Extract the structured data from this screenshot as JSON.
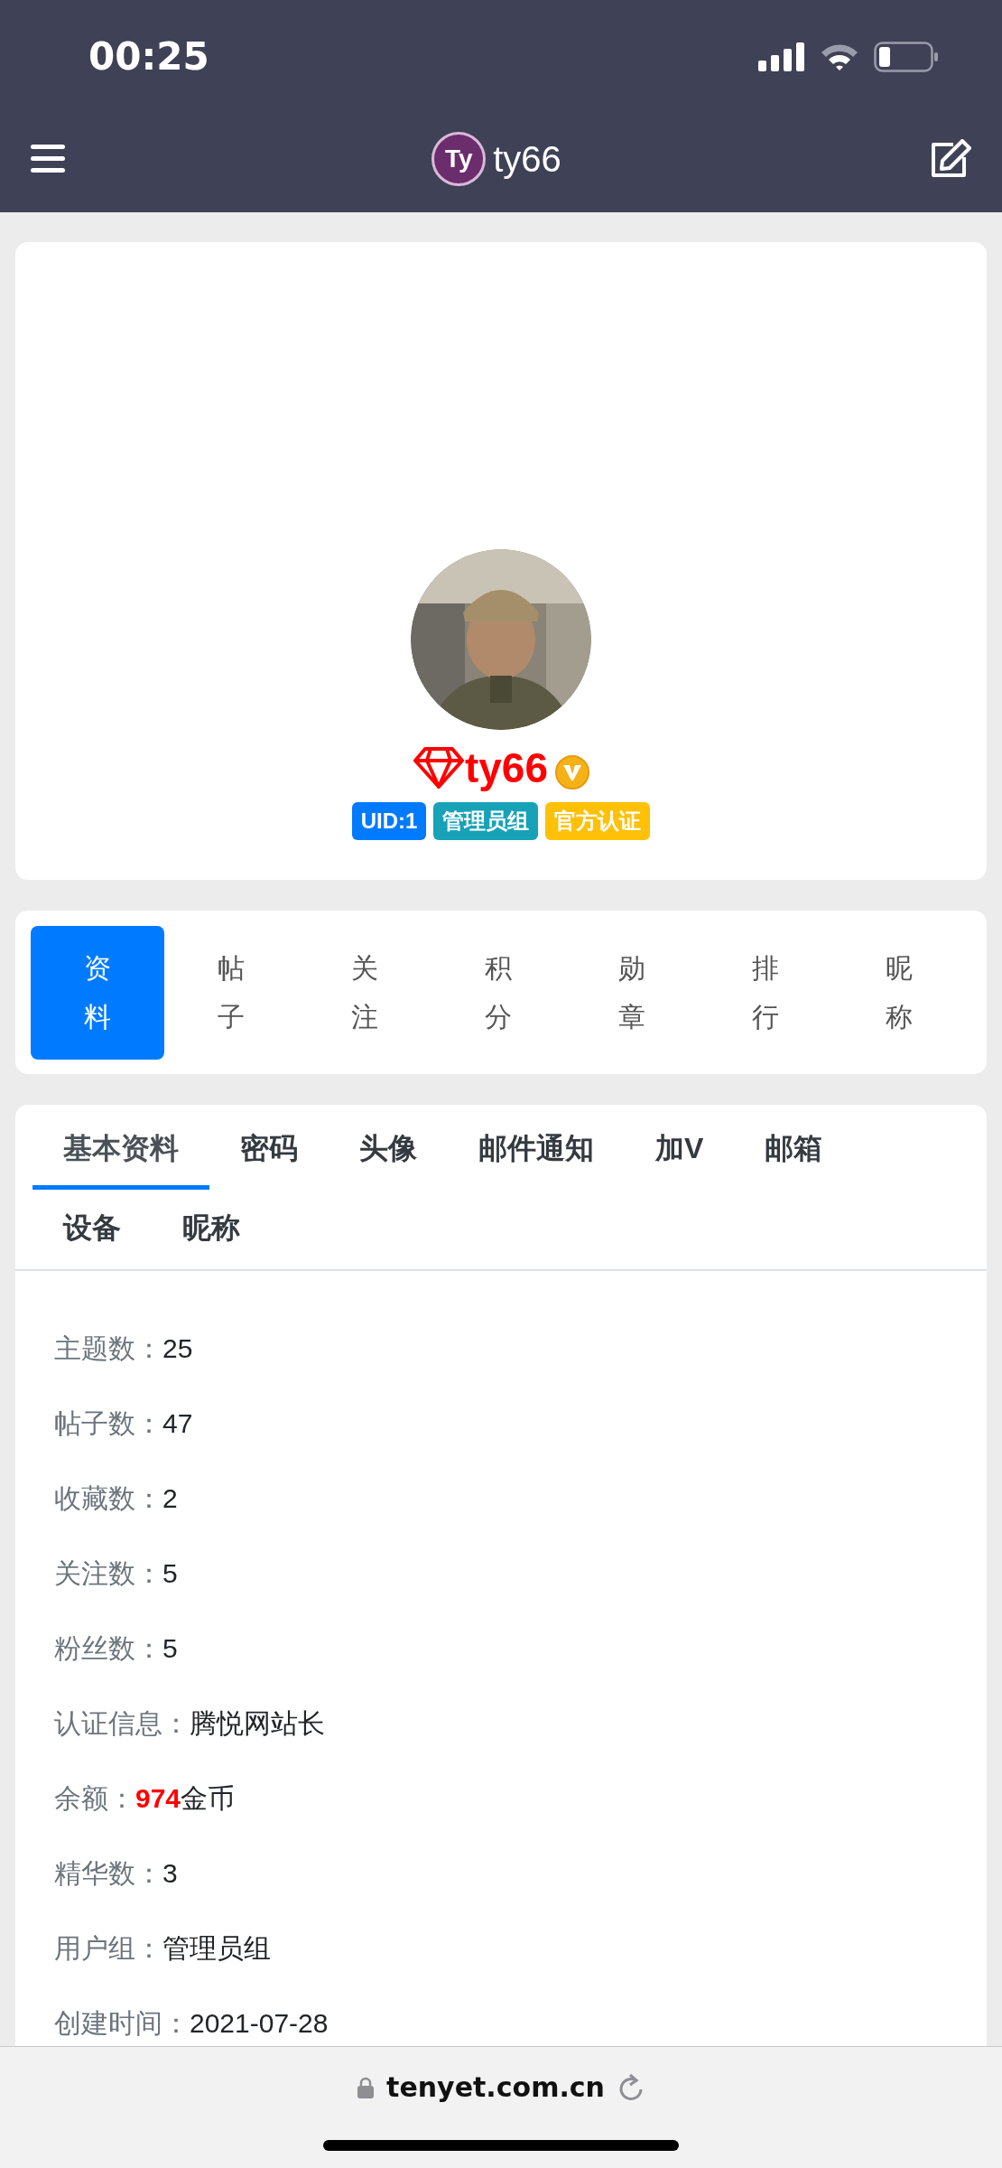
{
  "status_bar": {
    "time": "00:25"
  },
  "nav": {
    "title": "ty66",
    "logo_text": "Ty"
  },
  "profile": {
    "name": "ty66",
    "verified": true,
    "badges": [
      {
        "text": "UID:1",
        "color": "#007bff"
      },
      {
        "text": "管理员组",
        "color": "#17a2b8"
      },
      {
        "text": "官方认证",
        "color": "#ffc107"
      }
    ]
  },
  "side_tabs": [
    {
      "label": "资料",
      "selected": true
    },
    {
      "label": "帖子",
      "selected": false
    },
    {
      "label": "关注",
      "selected": false
    },
    {
      "label": "积分",
      "selected": false
    },
    {
      "label": "勋章",
      "selected": false
    },
    {
      "label": "排行",
      "selected": false
    },
    {
      "label": "昵称",
      "selected": false
    }
  ],
  "settings_tabs": [
    {
      "label": "基本资料",
      "selected": true
    },
    {
      "label": "密码",
      "selected": false
    },
    {
      "label": "头像",
      "selected": false
    },
    {
      "label": "邮件通知",
      "selected": false
    },
    {
      "label": "加V",
      "selected": false
    },
    {
      "label": "邮箱",
      "selected": false
    },
    {
      "label": "设备",
      "selected": false
    },
    {
      "label": "昵称",
      "selected": false
    }
  ],
  "info_rows": [
    {
      "kind": "plain",
      "label": "主题数：",
      "value": "25"
    },
    {
      "kind": "plain",
      "label": "帖子数：",
      "value": "47"
    },
    {
      "kind": "plain",
      "label": "收藏数：",
      "value": "2"
    },
    {
      "kind": "plain",
      "label": "关注数：",
      "value": "5"
    },
    {
      "kind": "plain",
      "label": "粉丝数：",
      "value": "5"
    },
    {
      "kind": "plain",
      "label": "认证信息：",
      "value": "腾悦网站长"
    },
    {
      "kind": "money",
      "label": "余额：",
      "amount": "974",
      "unit": "金币"
    },
    {
      "kind": "plain",
      "label": "精华数：",
      "value": "3"
    },
    {
      "kind": "plain",
      "label": "用户组：",
      "value": "管理员组"
    },
    {
      "kind": "plain",
      "label": "创建时间：",
      "value": "2021-07-28"
    }
  ],
  "browser": {
    "url": "tenyet.com.cn"
  }
}
